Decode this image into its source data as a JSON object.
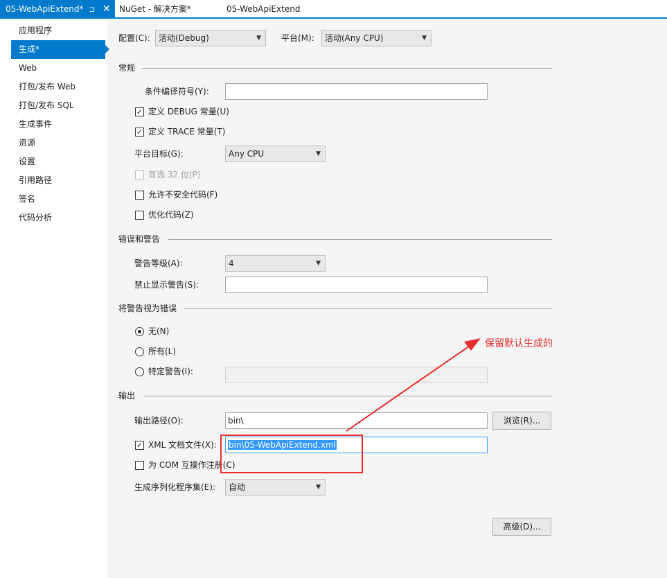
{
  "tabs": [
    {
      "label": "05-WebApiExtend*",
      "pin": "⊐",
      "close": "✕"
    },
    {
      "label": "NuGet - 解决方案*"
    },
    {
      "label": "05-WebApiExtend"
    }
  ],
  "sidebar": {
    "items": [
      {
        "label": "应用程序"
      },
      {
        "label": "生成*"
      },
      {
        "label": "Web"
      },
      {
        "label": "打包/发布 Web"
      },
      {
        "label": "打包/发布 SQL"
      },
      {
        "label": "生成事件"
      },
      {
        "label": "资源"
      },
      {
        "label": "设置"
      },
      {
        "label": "引用路径"
      },
      {
        "label": "签名"
      },
      {
        "label": "代码分析"
      }
    ]
  },
  "top": {
    "config_label": "配置(C):",
    "config_value": "活动(Debug)",
    "platform_label": "平台(M):",
    "platform_value": "活动(Any CPU)"
  },
  "general": {
    "title": "常规",
    "symbols_label": "条件编译符号(Y):",
    "symbols_value": "",
    "debug_label": "定义 DEBUG 常量(U)",
    "debug_checked": true,
    "trace_label": "定义 TRACE 常量(T)",
    "trace_checked": true,
    "platform_target_label": "平台目标(G):",
    "platform_target_value": "Any CPU",
    "prefer32_label": "首选 32 位(P)",
    "unsafe_label": "允许不安全代码(F)",
    "optimize_label": "优化代码(Z)"
  },
  "errors": {
    "title": "错误和警告",
    "level_label": "警告等级(A):",
    "level_value": "4",
    "suppress_label": "禁止显示警告(S):",
    "suppress_value": ""
  },
  "treat": {
    "title": "将警告视为错误",
    "none_label": "无(N)",
    "all_label": "所有(L)",
    "specific_label": "特定警告(I):",
    "specific_value": ""
  },
  "output": {
    "title": "输出",
    "path_label": "输出路径(O):",
    "path_value": "bin\\",
    "browse_label": "浏览(R)...",
    "xml_label": "XML 文档文件(X):",
    "xml_checked": true,
    "xml_value": "bin\\05-WebApiExtend.xml",
    "com_label": "为 COM 互操作注册(C)",
    "serialization_label": "生成序列化程序集(E):",
    "serialization_value": "自动",
    "advanced_label": "高级(D)..."
  },
  "annotation": {
    "text": "保留默认生成的",
    "color": "#e62e2e"
  },
  "colors": {
    "accent": "#007acc"
  },
  "icons": {
    "check": "✓",
    "dropdown": "▼"
  }
}
